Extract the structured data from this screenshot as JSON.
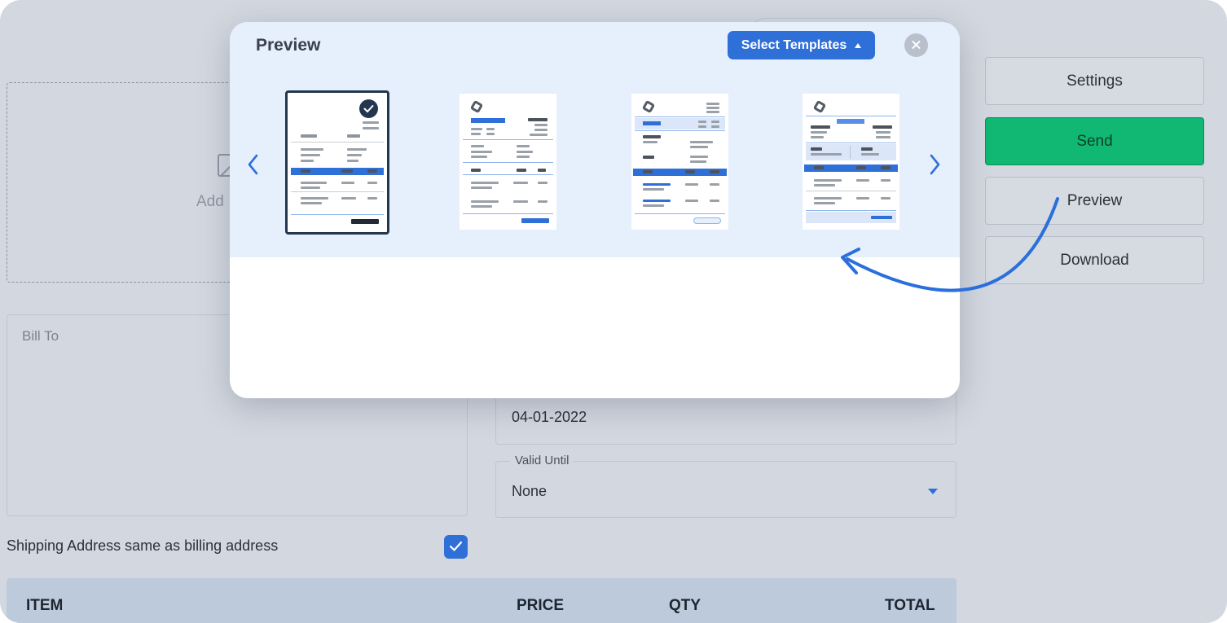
{
  "form": {
    "logo_placeholder": "Add",
    "bill_to_label": "Bill To",
    "date_value": "04-01-2022",
    "valid_until_label": "Valid Until",
    "valid_until_value": "None",
    "shipping_same_label": "Shipping Address same as billing address",
    "shipping_same_checked": true
  },
  "items_table": {
    "columns": [
      "ITEM",
      "PRICE",
      "QTY",
      "TOTAL"
    ]
  },
  "sidebar": {
    "buttons": [
      {
        "label": "Settings"
      },
      {
        "label": "Send"
      },
      {
        "label": "Preview"
      },
      {
        "label": "Download"
      }
    ],
    "send_color": "#10b873"
  },
  "modal": {
    "title": "Preview",
    "select_templates_label": "Select Templates",
    "templates": [
      {
        "selected": true
      },
      {
        "selected": false
      },
      {
        "selected": false
      },
      {
        "selected": false
      }
    ],
    "accent_color": "#2f6fd8"
  }
}
